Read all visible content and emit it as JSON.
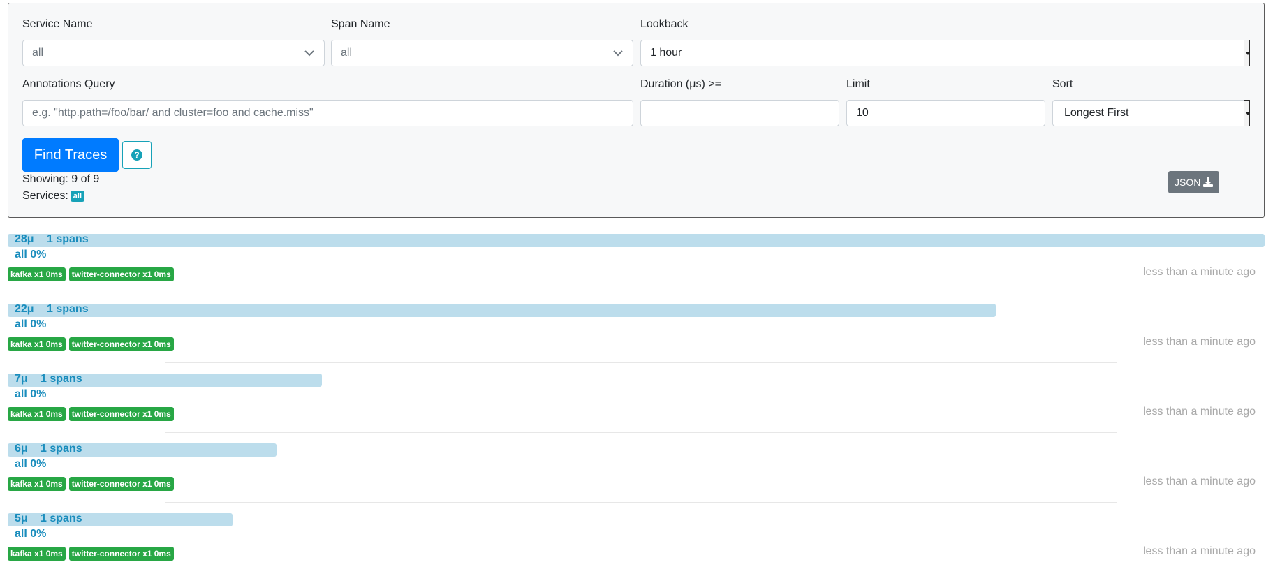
{
  "form": {
    "service_name": {
      "label": "Service Name",
      "value": "all"
    },
    "span_name": {
      "label": "Span Name",
      "value": "all"
    },
    "lookback": {
      "label": "Lookback",
      "value": "1 hour"
    },
    "annotations": {
      "label": "Annotations Query",
      "placeholder": "e.g. \"http.path=/foo/bar/ and cluster=foo and cache.miss\""
    },
    "duration": {
      "label": "Duration (μs) >=",
      "value": ""
    },
    "limit": {
      "label": "Limit",
      "value": "10"
    },
    "sort": {
      "label": "Sort",
      "value": "Longest First"
    },
    "find_button": "Find Traces",
    "help_icon": "question-circle-icon"
  },
  "summary": {
    "showing_label": "Showing: 9 of 9",
    "services_label": "Services:",
    "services_badge": "all",
    "json_button": "JSON",
    "json_icon": "download-icon"
  },
  "traces": [
    {
      "duration": "28μ",
      "spans": "1 spans",
      "percent": "all 0%",
      "bar_fraction": 1.0,
      "tags": [
        "kafka x1 0ms",
        "twitter-connector x1 0ms"
      ],
      "time_ago": "less than a minute ago"
    },
    {
      "duration": "22μ",
      "spans": "1 spans",
      "percent": "all 0%",
      "bar_fraction": 0.786,
      "tags": [
        "kafka x1 0ms",
        "twitter-connector x1 0ms"
      ],
      "time_ago": "less than a minute ago"
    },
    {
      "duration": "7μ",
      "spans": "1 spans",
      "percent": "all 0%",
      "bar_fraction": 0.25,
      "tags": [
        "kafka x1 0ms",
        "twitter-connector x1 0ms"
      ],
      "time_ago": "less than a minute ago"
    },
    {
      "duration": "6μ",
      "spans": "1 spans",
      "percent": "all 0%",
      "bar_fraction": 0.214,
      "tags": [
        "kafka x1 0ms",
        "twitter-connector x1 0ms"
      ],
      "time_ago": "less than a minute ago"
    },
    {
      "duration": "5μ",
      "spans": "1 spans",
      "percent": "all 0%",
      "bar_fraction": 0.179,
      "tags": [
        "kafka x1 0ms",
        "twitter-connector x1 0ms"
      ],
      "time_ago": "less than a minute ago"
    }
  ],
  "colors": {
    "primary": "#007bff",
    "info": "#17a2b8",
    "success": "#28a745",
    "bar": "#bcddec",
    "trace_text": "#1a8dbd",
    "muted": "#a9a9a9"
  }
}
